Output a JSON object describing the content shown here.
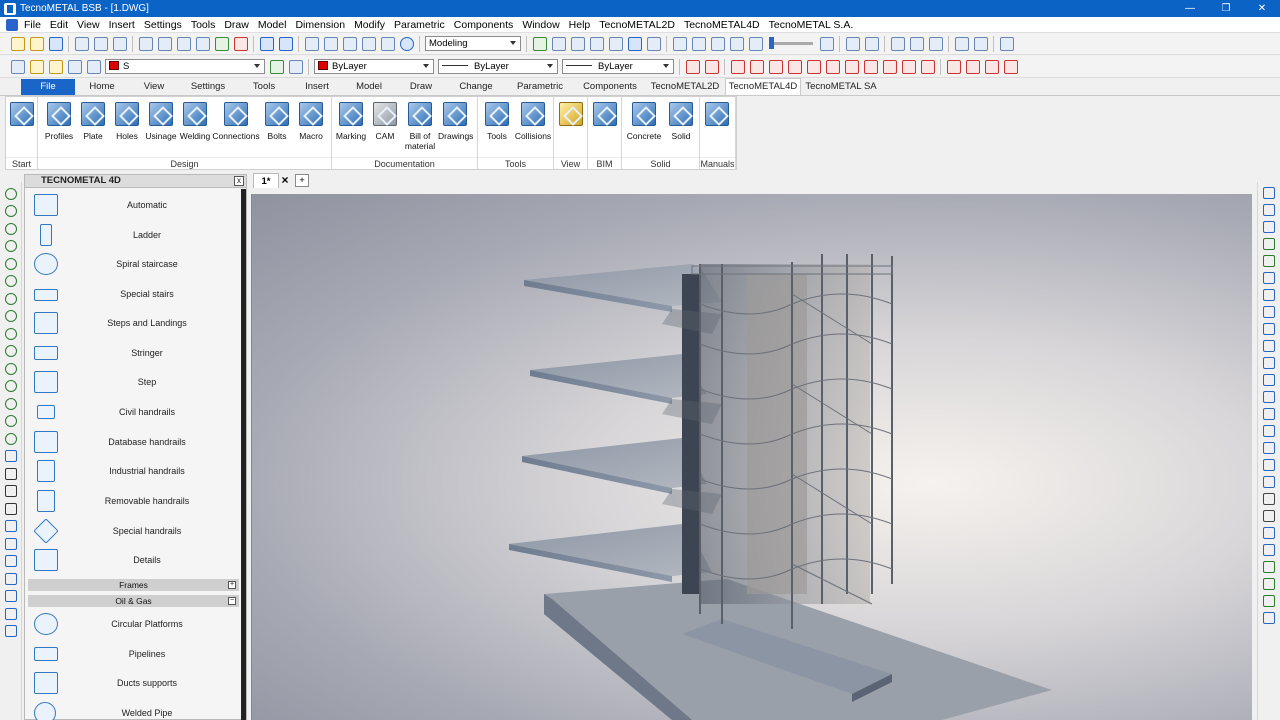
{
  "window": {
    "title": "TecnoMETAL BSB - [1.DWG]"
  },
  "menu": [
    "File",
    "Edit",
    "View",
    "Insert",
    "Settings",
    "Tools",
    "Draw",
    "Model",
    "Dimension",
    "Modify",
    "Parametric",
    "Components",
    "Window",
    "Help",
    "TecnoMETAL2D",
    "TecnoMETAL4D",
    "TecnoMETAL S.A."
  ],
  "toolbar": {
    "workspace": "Modeling",
    "layer": "S",
    "color": "ByLayer",
    "linetype": "ByLayer",
    "lineweight": "ByLayer",
    "color_swatch": "#dd0000"
  },
  "ribbon_tabs": [
    "File",
    "Home",
    "View",
    "Settings",
    "Tools",
    "Insert",
    "Model",
    "Draw",
    "Change",
    "Parametric",
    "Components",
    "TecnoMETAL2D",
    "TecnoMETAL4D",
    "TecnoMETAL SA"
  ],
  "ribbon_active": "TecnoMETAL4D",
  "ribbon": {
    "groups": [
      {
        "label": "Start",
        "buttons": [
          ""
        ]
      },
      {
        "label": "Design",
        "buttons": [
          "Profiles",
          "Plate",
          "Holes",
          "Usinage",
          "Welding",
          "Connections",
          "Bolts",
          "Macro"
        ]
      },
      {
        "label": "Documentation",
        "buttons": [
          "Marking",
          "CAM",
          "Bill of material",
          "Drawings"
        ]
      },
      {
        "label": "Tools",
        "buttons": [
          "Tools",
          "Collisions"
        ]
      },
      {
        "label": "View",
        "buttons": [
          ""
        ]
      },
      {
        "label": "BIM",
        "buttons": [
          ""
        ]
      },
      {
        "label": "Solid",
        "buttons": [
          "Concrete",
          "Solid"
        ]
      },
      {
        "label": "Manuals",
        "buttons": [
          ""
        ]
      }
    ]
  },
  "panel": {
    "title": "TECNOMETAL 4D",
    "close": "x",
    "items": [
      "Automatic",
      "Ladder",
      "Spiral staircase",
      "Special stairs",
      "Steps and Landings",
      "Stringer",
      "Step",
      "Civil handrails",
      "Database handrails",
      "Industrial handrails",
      "Removable handrails",
      "Special handrails",
      "Details"
    ],
    "sections": [
      {
        "label": "Frames",
        "toggle": "+"
      },
      {
        "label": "Oil & Gas",
        "toggle": "−"
      }
    ],
    "oil_gas_items": [
      "Circular Platforms",
      "Pipelines",
      "Ducts supports",
      "Welded Pipe"
    ]
  },
  "doc_tabs": {
    "current": "1*",
    "close": "×",
    "add": "+"
  },
  "colors": {
    "titlebar": "#0c63c6",
    "file_tab": "#1a66c8",
    "accent": "#2a65c4"
  }
}
